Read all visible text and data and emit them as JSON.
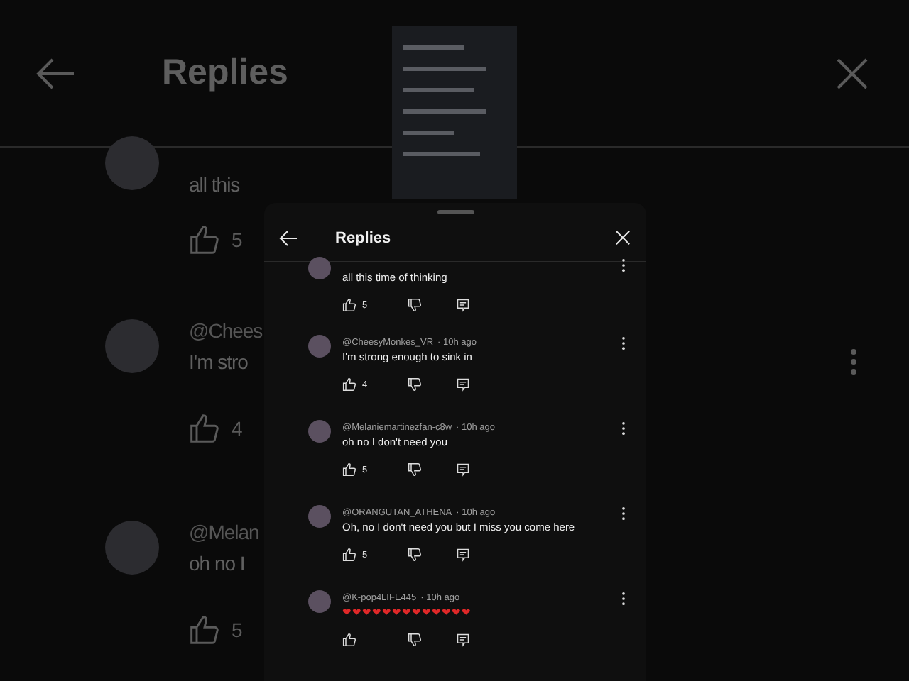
{
  "background": {
    "title": "Replies",
    "comments": [
      {
        "text": "all this",
        "likes": "5"
      },
      {
        "author": "@Chees",
        "text": "I'm stro",
        "likes": "4"
      },
      {
        "author": "@Melan",
        "text": "oh no I",
        "likes": "5"
      }
    ]
  },
  "panel": {
    "title": "Replies",
    "comments": [
      {
        "text": "all this time of thinking",
        "likes": "5"
      },
      {
        "author": "@CheesyMonkes_VR",
        "time": "· 10h ago",
        "text": "I'm strong enough to sink in",
        "likes": "4"
      },
      {
        "author": "@Melaniemartinezfan-c8w",
        "time": "· 10h ago",
        "text": "oh no I don't need you",
        "likes": "5"
      },
      {
        "author": "@ORANGUTAN_ATHENA",
        "time": "· 10h ago",
        "text": "Oh, no I don't need you but I miss you come here",
        "likes": "5"
      },
      {
        "author": "@K-pop4LIFE445",
        "time": "· 10h ago",
        "text": "❤❤❤❤❤❤❤❤❤❤❤❤❤",
        "kind": "hearts"
      }
    ]
  }
}
